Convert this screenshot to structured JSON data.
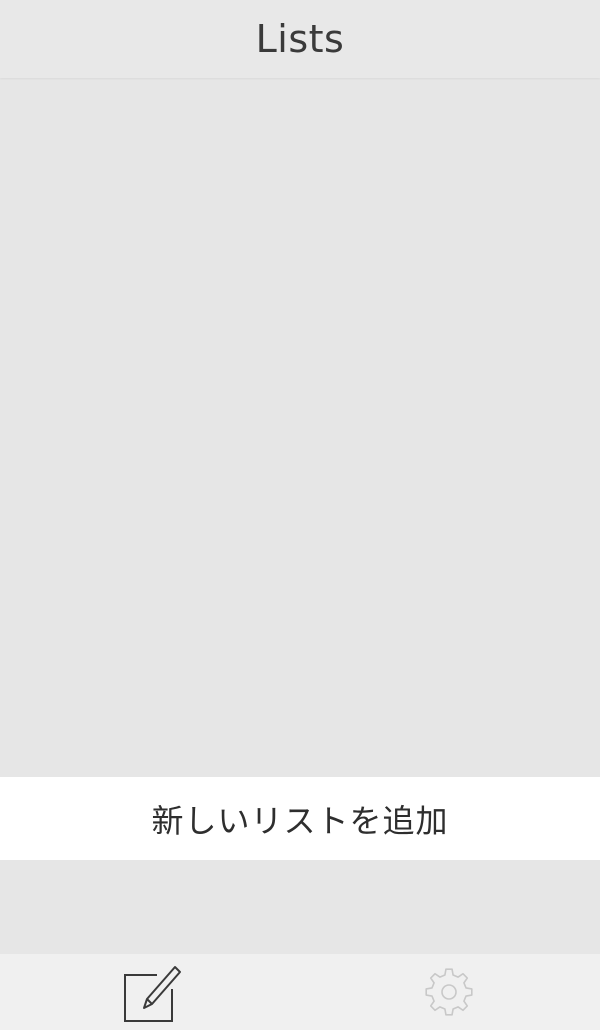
{
  "nav": {
    "title": "Lists"
  },
  "lists": {
    "items": []
  },
  "add_list": {
    "label": "新しいリストを追加"
  },
  "tab_bar": {
    "compose": {
      "icon": "compose-icon"
    },
    "settings": {
      "icon": "gear-icon"
    }
  },
  "colors": {
    "background": "#e6e6e6",
    "nav_background": "#e8e8e8",
    "row_background": "#ffffff",
    "tab_background": "#f0f0f0",
    "text": "#2e2e2e",
    "icon_active": "#3a3a3a",
    "icon_inactive": "#c8c8c8"
  }
}
